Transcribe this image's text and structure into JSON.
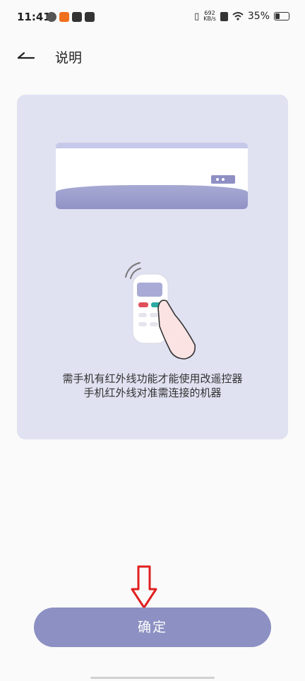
{
  "status_bar": {
    "time": "11:41",
    "net_speed_value": "692",
    "net_speed_unit": "KB/s",
    "battery": "35%"
  },
  "header": {
    "title": "说明"
  },
  "illustration": {
    "line1": "需手机有红外线功能才能使用改遥控器",
    "line2": "手机红外线对准需连接的机器"
  },
  "footer": {
    "confirm_label": "确定"
  },
  "colors": {
    "accent": "#8c90c2",
    "card_bg": "#e0e1f1",
    "annotation_arrow": "#e02020"
  }
}
